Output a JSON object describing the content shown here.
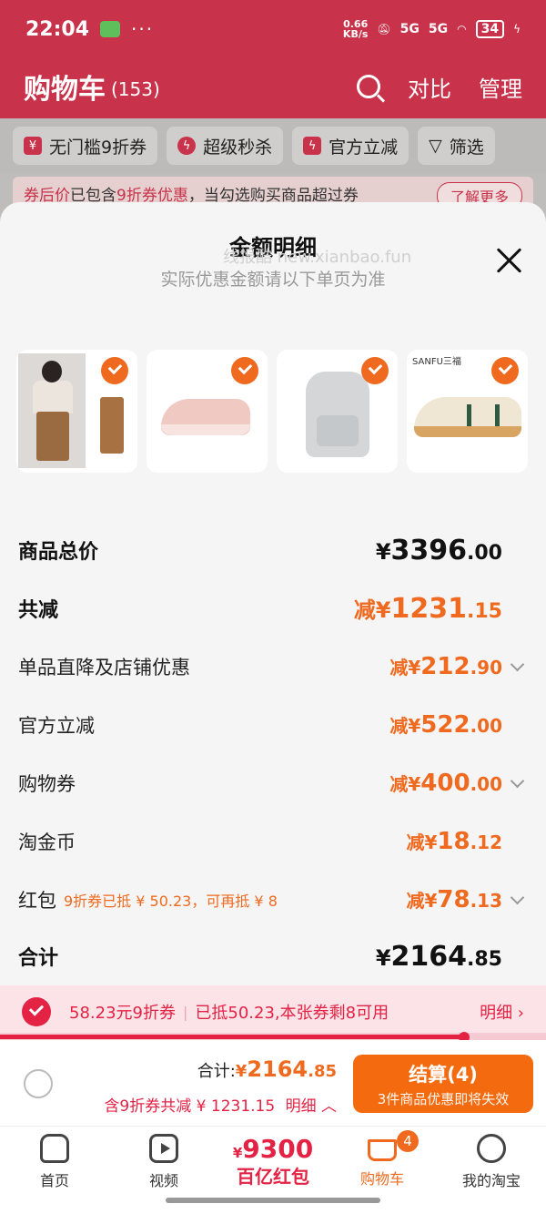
{
  "status_bar": {
    "time": "22:04",
    "net_speed_value": "0.66",
    "net_speed_unit": "KB/s",
    "signal_1": "5G",
    "signal_2": "5G",
    "battery": "34",
    "dots": "···"
  },
  "cart_header": {
    "title": "购物车",
    "count": "(153)",
    "compare": "对比",
    "manage": "管理"
  },
  "filter_chips": [
    {
      "icon": "¥",
      "label": "无门槛9折券"
    },
    {
      "icon": "ϟ",
      "label": "超级秒杀"
    },
    {
      "icon": "ϟ",
      "label": "官方立减"
    },
    {
      "icon": "▽",
      "label": "筛选"
    }
  ],
  "notice": {
    "prefix": "券后价",
    "text_a": "已包含",
    "highlight": "9折券优惠",
    "text_b": "，当勾选购买商品超过券",
    "more": "了解更多"
  },
  "sheet": {
    "title": "金额明细",
    "watermark": "线报酷 new.xianbao.fun",
    "subtitle": "实际优惠金额请以下单页为准",
    "thumbs": [
      {
        "name": "apparel-set",
        "brand": ""
      },
      {
        "name": "pink-sneaker",
        "brand": ""
      },
      {
        "name": "grey-backpack",
        "brand": ""
      },
      {
        "name": "white-sneaker",
        "brand": "SANFU三福"
      }
    ],
    "rows": [
      {
        "label": "商品总价",
        "note": "",
        "prefix": "¥",
        "int": "3396",
        "dec": ".00",
        "bold": true,
        "dark": true,
        "chevron": false
      },
      {
        "label": "共减",
        "note": "",
        "prefix": "减¥",
        "int": "1231",
        "dec": ".15",
        "bold": true,
        "dark": false,
        "chevron": false
      },
      {
        "label": "单品直降及店铺优惠",
        "note": "",
        "prefix": "减¥",
        "int": "212",
        "dec": ".90",
        "bold": false,
        "dark": false,
        "chevron": true
      },
      {
        "label": "官方立减",
        "note": "",
        "prefix": "减¥",
        "int": "522",
        "dec": ".00",
        "bold": false,
        "dark": false,
        "chevron": false
      },
      {
        "label": "购物券",
        "note": "",
        "prefix": "减¥",
        "int": "400",
        "dec": ".00",
        "bold": false,
        "dark": false,
        "chevron": true
      },
      {
        "label": "淘金币",
        "note": "",
        "prefix": "减¥",
        "int": "18",
        "dec": ".12",
        "bold": false,
        "dark": false,
        "chevron": false
      },
      {
        "label": "红包",
        "note": "9折券已抵 ¥ 50.23，可再抵 ¥ 8",
        "prefix": "减¥",
        "int": "78",
        "dec": ".13",
        "bold": false,
        "dark": false,
        "chevron": true
      },
      {
        "label": "合计",
        "note": "",
        "prefix": "¥",
        "int": "2164",
        "dec": ".85",
        "bold": true,
        "dark": true,
        "chevron": false
      }
    ]
  },
  "coupon_strip": {
    "coupon_text": "58.23元9折券",
    "status_text": "已抵50.23,本张券剩8可用",
    "detail": "明细 ›",
    "progress": 0.85
  },
  "checkout": {
    "total_label": "合计:",
    "total_prefix": "¥",
    "total_int": "2164",
    "total_dec": ".85",
    "discount_text": "含9折券共减 ¥ 1231.15",
    "detail": "明细 ︿",
    "submit_label": "结算(4)",
    "submit_sub": "3件商品优惠即将失效"
  },
  "tabbar": {
    "home": "首页",
    "video": "视频",
    "promo_currency": "¥",
    "promo_amount": "9300",
    "promo_label": "百亿红包",
    "cart": "购物车",
    "cart_badge": "4",
    "me": "我的淘宝"
  }
}
